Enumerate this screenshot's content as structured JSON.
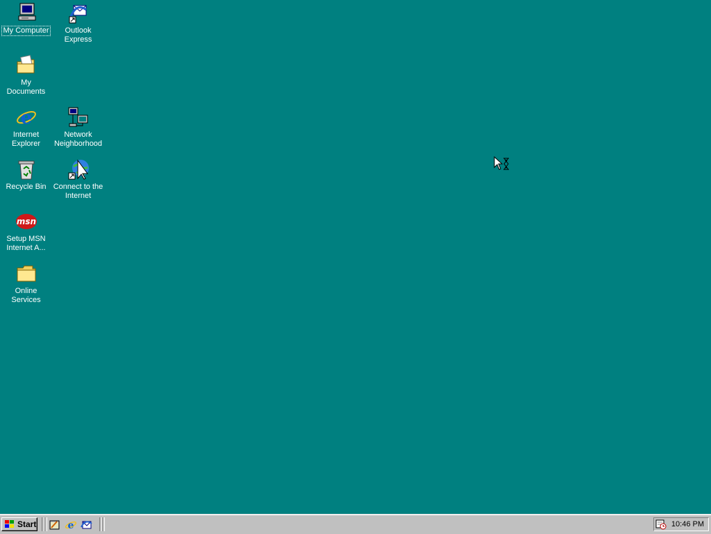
{
  "desktop": {
    "icons": {
      "my_computer": "My Computer",
      "outlook_express": "Outlook Express",
      "my_documents": "My Documents",
      "internet_explorer": "Internet Explorer",
      "network_neighborhood": "Network Neighborhood",
      "recycle_bin": "Recycle Bin",
      "connect_internet": "Connect to the Internet",
      "setup_msn": "Setup MSN Internet A...",
      "online_services": "Online Services"
    },
    "background_color": "#008080",
    "cursor": "busy-arrow-hourglass"
  },
  "taskbar": {
    "start_label": "Start",
    "quick_launch": [
      "show-desktop",
      "internet-explorer",
      "outlook-express"
    ],
    "clock": "10:46 PM",
    "tray_icon": "task-scheduler"
  }
}
